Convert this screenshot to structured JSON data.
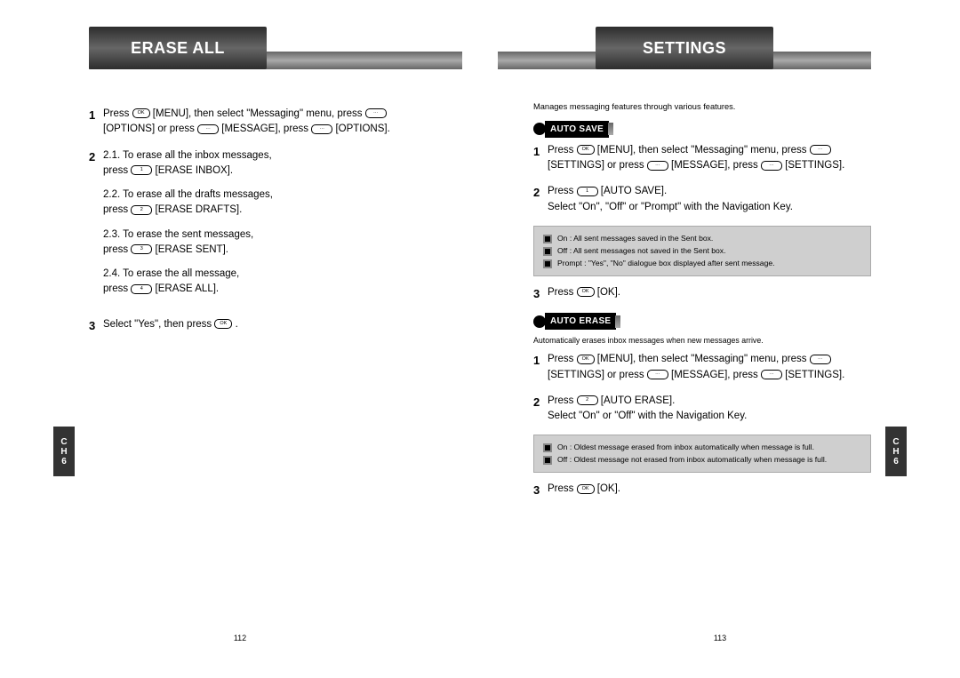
{
  "left": {
    "title": "ERASE ALL",
    "chapter": {
      "line1": "C",
      "line2": "H",
      "line3": "6"
    },
    "page_number": "112",
    "steps": {
      "s1": "Press OK [MENU], then select \"Messaging\" menu, press ⌂ [OPTIONS] or press ⌂ [MESSAGE], press ⌂ [OPTIONS].",
      "s2_1": "2.1. To erase all the inbox messages, press 1 [ERASE INBOX].",
      "s2_2": "2.2. To erase all the drafts messages, press 2 [ERASE DRAFTS].",
      "s2_3": "2.3. To erase the sent messages, press 3 [ERASE SENT].",
      "s2_4": "2.4. To erase the all message, press 4 [ERASE ALL].",
      "s3": "Select \"Yes\", then press OK ."
    }
  },
  "right": {
    "title": "SETTINGS",
    "chapter": {
      "line1": "C",
      "line2": "H",
      "line3": "6"
    },
    "page_number": "113",
    "lead": "Manages messaging features through various features.",
    "auto_save": {
      "heading": "AUTO SAVE",
      "s1": "Press OK [MENU], then select \"Messaging\" menu, press ⌂ [SETTINGS] or press ⌂ [MESSAGE], press ⌂ [SETTINGS].",
      "s2": "Press 1 [AUTO SAVE]. Select \"On\", \"Off\" or \"Prompt\" with the Navigation Key.",
      "info": {
        "on": "On : All sent messages saved in the Sent box.",
        "off": "Off : All sent messages not saved in the Sent box.",
        "prompt": "Prompt : \"Yes\", \"No\" dialogue box displayed after sent message."
      },
      "s3": "Press OK [OK]."
    },
    "auto_erase": {
      "heading": "AUTO ERASE",
      "caption": "Automatically erases inbox messages when new messages arrive.",
      "s1": "Press OK [MENU], then select \"Messaging\" menu, press ⌂ [SETTINGS] or press ⌂ [MESSAGE], press ⌂ [SETTINGS].",
      "s2": "Press 2 [AUTO ERASE]. Select \"On\" or \"Off\" with the Navigation Key.",
      "info": {
        "on": "On : Oldest message erased from inbox automatically when message is full.",
        "off": "Off : Oldest message not erased from inbox automatically when message is full."
      },
      "s3": "Press OK [OK]."
    }
  }
}
